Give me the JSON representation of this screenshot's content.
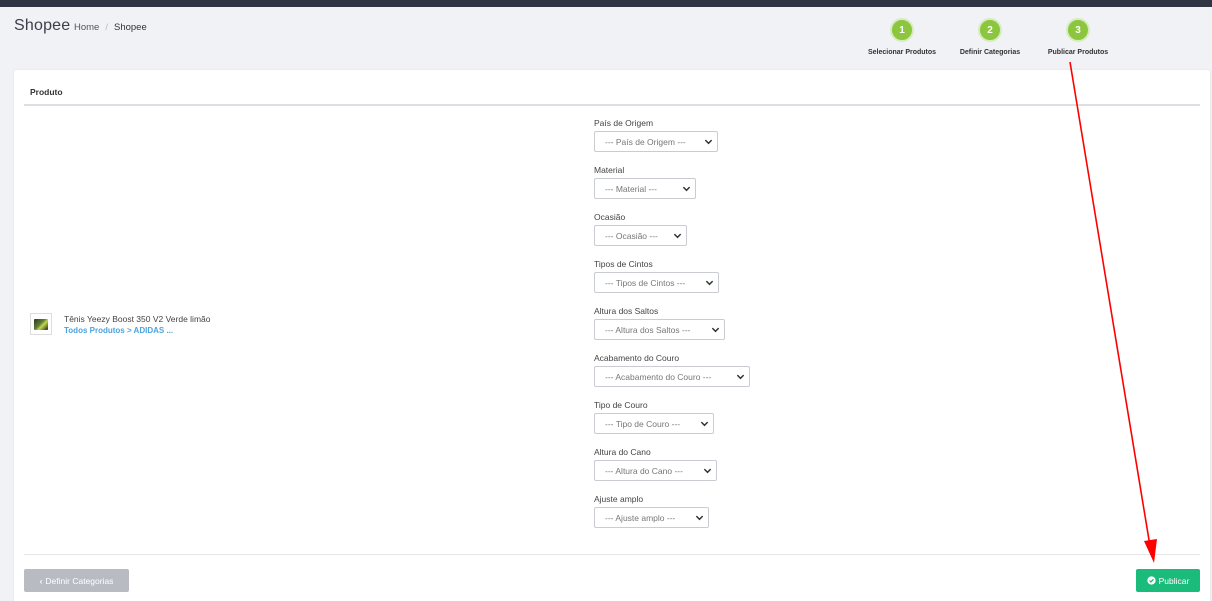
{
  "header": {
    "title": "Shopee",
    "breadcrumb": [
      {
        "label": "Home"
      },
      {
        "label": "Shopee"
      }
    ]
  },
  "steps": [
    {
      "number": "1",
      "label": "Selecionar Produtos"
    },
    {
      "number": "2",
      "label": "Definir Categorias"
    },
    {
      "number": "3",
      "label": "Publicar Produtos"
    }
  ],
  "table": {
    "header": "Produto"
  },
  "product": {
    "name": "Tênis Yeezy Boost 350 V2 Verde limão",
    "path": "Todos Produtos > ADIDAS ..."
  },
  "fields": [
    {
      "label": "País de Origem",
      "value": "--- País de Origem ---"
    },
    {
      "label": "Material",
      "value": "--- Material ---"
    },
    {
      "label": "Ocasião",
      "value": "--- Ocasião ---"
    },
    {
      "label": "Tipos de Cintos",
      "value": "--- Tipos de Cintos ---"
    },
    {
      "label": "Altura dos Saltos",
      "value": "--- Altura dos Saltos ---"
    },
    {
      "label": "Acabamento do Couro",
      "value": "--- Acabamento do Couro ---"
    },
    {
      "label": "Tipo de Couro",
      "value": "--- Tipo de Couro ---"
    },
    {
      "label": "Altura do Cano",
      "value": "--- Altura do Cano ---"
    },
    {
      "label": "Ajuste amplo",
      "value": "--- Ajuste amplo ---"
    }
  ],
  "buttons": {
    "back": "Definir Categorias",
    "publish": "Publicar"
  },
  "colors": {
    "step": "#8cc63e",
    "publish": "#1bbc7b",
    "back": "#b8bcc2",
    "link": "#4aa3df",
    "annotation_arrow": "#ff0000"
  }
}
